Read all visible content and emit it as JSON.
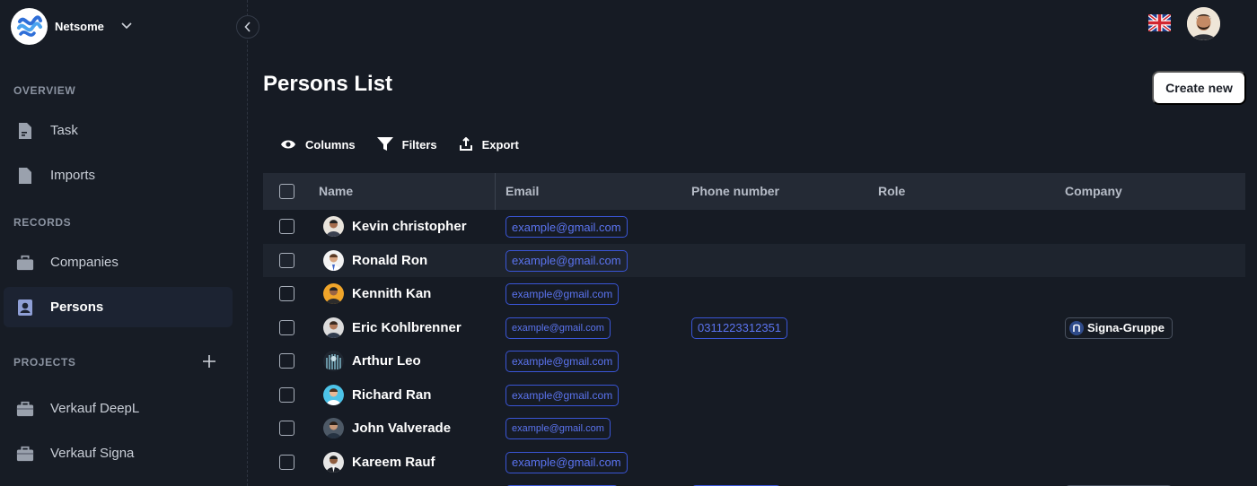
{
  "brand": {
    "name": "Netsome"
  },
  "sidebar": {
    "sections": {
      "overview": "OVERVIEW",
      "records": "RECORDS",
      "projects": "PROJECTS"
    },
    "items": [
      {
        "label": "Task",
        "icon": "task-icon"
      },
      {
        "label": "Imports",
        "icon": "file-icon"
      },
      {
        "label": "Companies",
        "icon": "briefcase-icon"
      },
      {
        "label": "Persons",
        "icon": "person-icon",
        "active": true
      },
      {
        "label": "Verkauf DeepL",
        "icon": "project-icon"
      },
      {
        "label": "Verkauf Signa",
        "icon": "project-icon"
      }
    ]
  },
  "header": {
    "title": "Persons List",
    "create_label": "Create new",
    "language_flag": "uk-flag-icon"
  },
  "toolbar": {
    "columns_label": "Columns",
    "filters_label": "Filters",
    "export_label": "Export"
  },
  "table": {
    "columns": [
      "Name",
      "Email",
      "Phone number",
      "Role",
      "Company"
    ],
    "rows": [
      {
        "name": "Kevin christopher",
        "email_user": "example",
        "email_domain": "@gmail.com",
        "phone": "",
        "role": "",
        "company": ""
      },
      {
        "name": "Ronald Ron",
        "email_user": "example",
        "email_domain": "@gmail.com",
        "phone": "",
        "role": "",
        "company": ""
      },
      {
        "name": "Kennith Kan",
        "email_user": "example",
        "email_domain": "@gmail.com",
        "phone": "",
        "role": "",
        "company": ""
      },
      {
        "name": "Eric Kohlbrenner",
        "email_user": "example",
        "email_domain": "@gmail.com",
        "phone": "0311223312351",
        "role": "",
        "company": "Signa-Gruppe"
      },
      {
        "name": "Arthur Leo",
        "email_user": "example",
        "email_domain": "@gmail.com",
        "phone": "",
        "role": "",
        "company": ""
      },
      {
        "name": "Richard Ran",
        "email_user": "example",
        "email_domain": "@gmail.com",
        "phone": "",
        "role": "",
        "company": ""
      },
      {
        "name": "John Valverade",
        "email_user": "example",
        "email_domain": "@gmail.com",
        "phone": "",
        "role": "",
        "company": ""
      },
      {
        "name": "Kareem Rauf",
        "email_user": "example",
        "email_domain": "@gmail.com",
        "phone": "",
        "role": "",
        "company": ""
      }
    ]
  },
  "colors": {
    "background": "#161b24",
    "accent_blue": "#5b74f0",
    "header_row": "#242a35"
  }
}
